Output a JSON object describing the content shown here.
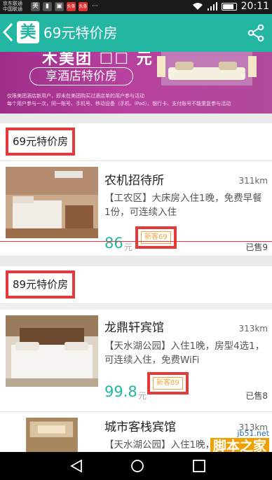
{
  "status_bar": {
    "carrier_line1": "京东联通",
    "carrier_line2": "中国联通",
    "time": "20:11",
    "app_icons": [
      "美",
      "头条",
      "头条",
      "···"
    ],
    "battery_level": 0.85
  },
  "titlebar": {
    "back_icon": "chevron-left-icon",
    "logo": "美",
    "title": "69元特价房",
    "share_icon": "share-icon",
    "accent_color": "#23b6a2"
  },
  "banner": {
    "headline": "木美团 ☐☐ 元",
    "pill": "享酒店特价房",
    "notes": [
      "仅限美团酒店新用户，即未在美团购买过酒店单的用户参与活动",
      "每个用户参与一次，同一账号、手机号、移动设备（手机、iPad）、银行卡、支付账号不能重复参与活动"
    ]
  },
  "sections": [
    {
      "label": "69元特价房",
      "hotels": [
        {
          "name": "农机招待所",
          "distance": "311km",
          "description": "【工农区】大床房入住1晚，免费早餐1份，可连续入住",
          "price": "86",
          "unit": "元",
          "badge": "新客69",
          "sold": "已售9"
        }
      ]
    },
    {
      "label": "89元特价房",
      "hotels": [
        {
          "name": "龙鼎轩宾馆",
          "distance": "313km",
          "description": "【天水湖公园】入住1晚，房型4选1，可连续入住，免费WiFi",
          "price": "99.8",
          "unit": "元",
          "badge": "新客89",
          "sold": "已售8"
        },
        {
          "name": "城市客栈宾馆",
          "distance": "313km",
          "description": "【天水湖公园】入住1晚，..."
        }
      ]
    }
  ],
  "nav_bar": {
    "icons": [
      "back-triangle-icon",
      "home-circle-icon",
      "recents-square-icon"
    ]
  },
  "watermark": {
    "site": "jb51.net",
    "brand": "脚本之家"
  }
}
